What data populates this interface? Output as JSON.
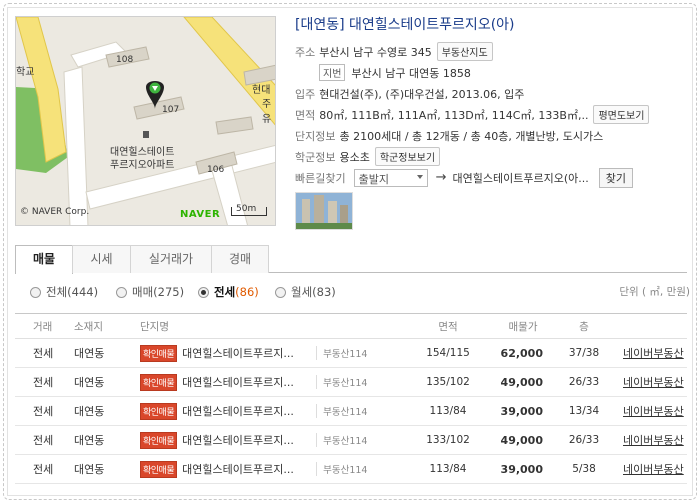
{
  "map": {
    "labels": {
      "school": "학교",
      "bldg108": "108",
      "bldg107": "107",
      "bldg106": "106",
      "apt_line1": "대연힐스테이트",
      "apt_line2": "푸르지오아파트",
      "hyundai1": "현대",
      "hyundai2": "주유"
    },
    "copyright": "© NAVER Corp.",
    "logo": "NAVER",
    "scale": "50m"
  },
  "info": {
    "title": "[대연동] 대연힐스테이트푸르지오(아)",
    "address_label": "주소",
    "address": "부산시 남구 수영로 345",
    "address_btn": "부동산지도",
    "jibun_tag": "지번",
    "jibun": "부산시 남구 대연동 1858",
    "move_in_label": "입주",
    "move_in": "현대건설(주), (주)대우건설, 2013.06, 입주",
    "area_label": "면적",
    "area": "80㎡, 111B㎡, 111A㎡, 113D㎡, 114C㎡, 133B㎡,..",
    "area_btn": "평면도보기",
    "complex_label": "단지정보",
    "complex": "총 2100세대 / 총 12개동 / 총 40층, 개별난방, 도시가스",
    "school_label": "학군정보",
    "school": "용소초",
    "school_btn": "학군정보보기",
    "route_label": "빠른길찾기",
    "route_from": "출발지",
    "route_arrow": "→",
    "route_to": "대연힐스테이트푸르지오(아...",
    "route_btn": "찾기"
  },
  "tabs": [
    "매물",
    "시세",
    "실거래가",
    "경매"
  ],
  "filters": [
    {
      "label": "전체",
      "count": "(444)",
      "selected": false
    },
    {
      "label": "매매",
      "count": "(275)",
      "selected": false
    },
    {
      "label": "전세",
      "count": "(86)",
      "selected": true
    },
    {
      "label": "월세",
      "count": "(83)",
      "selected": false
    }
  ],
  "unit_note": "단위 ( ㎡, 만원)",
  "table": {
    "headers": [
      "거래",
      "소재지",
      "단지명",
      "면적",
      "매물가",
      "층"
    ],
    "badge": "확인매물",
    "rows": [
      {
        "type": "전세",
        "loc": "대연동",
        "name": "대연힐스테이트푸르지...",
        "agent": "부동산114",
        "area": "154/115",
        "price": "62,000",
        "floor": "37/38",
        "link": "네이버부동산"
      },
      {
        "type": "전세",
        "loc": "대연동",
        "name": "대연힐스테이트푸르지...",
        "agent": "부동산114",
        "area": "135/102",
        "price": "49,000",
        "floor": "26/33",
        "link": "네이버부동산"
      },
      {
        "type": "전세",
        "loc": "대연동",
        "name": "대연힐스테이트푸르지...",
        "agent": "부동산114",
        "area": "113/84",
        "price": "39,000",
        "floor": "13/34",
        "link": "네이버부동산"
      },
      {
        "type": "전세",
        "loc": "대연동",
        "name": "대연힐스테이트푸르지...",
        "agent": "부동산114",
        "area": "133/102",
        "price": "49,000",
        "floor": "26/33",
        "link": "네이버부동산"
      },
      {
        "type": "전세",
        "loc": "대연동",
        "name": "대연힐스테이트푸르지...",
        "agent": "부동산114",
        "area": "113/84",
        "price": "39,000",
        "floor": "5/38",
        "link": "네이버부동산"
      }
    ]
  },
  "colors": {
    "title": "#1a3c8a",
    "badge": "#d9472b",
    "selected_count": "#e05a00",
    "naver_green": "#2db400",
    "map_road": "#f6e27a",
    "map_green": "#7fbf63"
  }
}
